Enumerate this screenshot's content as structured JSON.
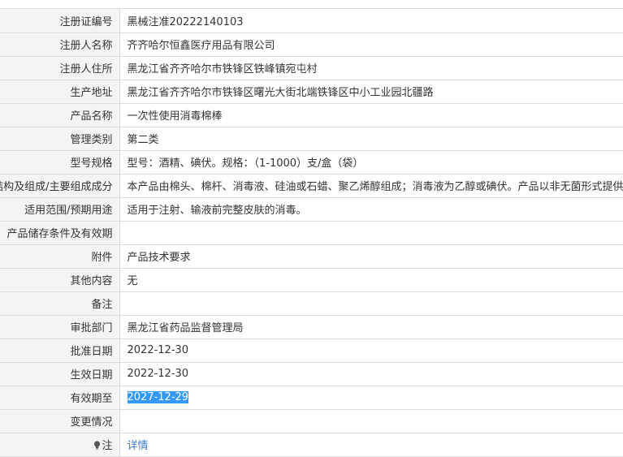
{
  "rows": [
    {
      "label": "注册证编号",
      "value": "黑械注准20222140103"
    },
    {
      "label": "注册人名称",
      "value": "齐齐哈尔恒鑫医疗用品有限公司"
    },
    {
      "label": "注册人住所",
      "value": "黑龙江省齐齐哈尔市铁锋区铁峰镇宛屯村"
    },
    {
      "label": "生产地址",
      "value": "黑龙江省齐齐哈尔市铁锋区曙光大街北端铁锋区中小工业园北疆路"
    },
    {
      "label": "产品名称",
      "value": "一次性使用消毒棉棒"
    },
    {
      "label": "管理类别",
      "value": "第二类"
    },
    {
      "label": "型号规格",
      "value": "型号：酒精、碘伏。规格：（1-1000）支/盒（袋）"
    },
    {
      "label": "结构及组成/主要组成成分",
      "value": "本产品由棉头、棉杆、消毒液、硅油或石蜡、聚乙烯醇组成；消毒液为乙醇或碘伏。产品以非无菌形式提供。"
    },
    {
      "label": "适用范围/预期用途",
      "value": "适用于注射、输液前完整皮肤的消毒。"
    },
    {
      "label": "产品储存条件及有效期",
      "value": ""
    },
    {
      "label": "附件",
      "value": "产品技术要求"
    },
    {
      "label": "其他内容",
      "value": "无"
    },
    {
      "label": "备注",
      "value": ""
    },
    {
      "label": "审批部门",
      "value": "黑龙江省药品监督管理局"
    },
    {
      "label": "批准日期",
      "value": "2022-12-30"
    },
    {
      "label": "生效日期",
      "value": "2022-12-30"
    },
    {
      "label": "有效期至",
      "value": "2027-12-29"
    },
    {
      "label": "变更情况",
      "value": ""
    }
  ],
  "note_row": {
    "label": "注",
    "icon": "lightbulb-icon",
    "link_text": "详情"
  },
  "colors": {
    "label_bg": "#f4f4f4",
    "border": "#dcdcdc",
    "selection_bg": "#3399ff",
    "link": "#3e7bc6"
  }
}
